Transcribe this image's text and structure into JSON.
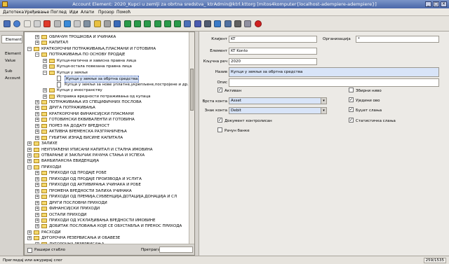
{
  "window": {
    "title": "Account Element: 2020_Kupci u zemlji za obrtna sredstva_ ktrAdmin@ktrl.kttorg [mitos4komputer{localhost-adempiere-adempiere}]",
    "close_glyph": "×",
    "max_glyph": "□",
    "min_glyph": "_"
  },
  "menu": [
    "Датотека",
    "Уређивање",
    "Поглед",
    "Иди",
    "Алати",
    "Прозор",
    "Помоћ"
  ],
  "toolbar": {
    "icons": [
      "undo-icon",
      "help-icon",
      "new-record-icon",
      "copy-record-icon",
      "delete-icon",
      "save-icon",
      "refresh-icon",
      "find-icon",
      "attachment-icon",
      "chat-icon",
      "history-icon",
      "home-icon",
      "parent-record-icon",
      "detail-record-icon",
      "first-record-icon",
      "previous-record-icon",
      "next-record-icon",
      "last-record-icon",
      "report-icon",
      "archive-icon",
      "print-icon",
      "zoom-across-icon",
      "active-workflows-icon",
      "requests-icon",
      "product-info-icon",
      "close-window-icon"
    ],
    "colors": [
      "#4a6fb8",
      "#4a7fd0",
      "#e8e6e0",
      "#d0d0d0",
      "#e03a2a",
      "#b8b8b8",
      "#3a8ad8",
      "#c8c8c8",
      "#8090a0",
      "#e8c040",
      "#a0a0a0",
      "#3a6ab8",
      "#2a9a4a",
      "#2a9a4a",
      "#2a9a4a",
      "#2a9a4a",
      "#2a9a4a",
      "#2a9a4a",
      "#4a6fb8",
      "#4a5ab0",
      "#505a70",
      "#3a7ac8",
      "#5070a0",
      "#606060",
      "#9090a0",
      "#d02020"
    ]
  },
  "left_tabs": [
    "Element",
    "Element Value",
    "Sub Account"
  ],
  "tree": {
    "nodes": [
      {
        "label": "ОБРАЧУН ТРОШКОВА И УЧИНАКА",
        "level": 1,
        "expanded": false,
        "folder": true
      },
      {
        "label": "КАПИТАЛ",
        "level": 1,
        "expanded": false,
        "folder": true
      },
      {
        "label": "КРАТКОРОЧНИ ПОТРАЖИВАЊА,ПЛАСМАНИ И ГОТОВИНА",
        "level": 0,
        "expanded": true,
        "folder": true
      },
      {
        "label": "ПОТРАЖИВАЊА ПО ОСНОВУ ПРОДАЈЕ",
        "level": 1,
        "expanded": true,
        "folder": true
      },
      {
        "label": "Купци-матична и зависна правна лица",
        "level": 2,
        "expanded": false,
        "folder": true
      },
      {
        "label": "Купци-остала повезана правна лица",
        "level": 2,
        "expanded": false,
        "folder": true
      },
      {
        "label": "Купци у земљи",
        "level": 2,
        "expanded": true,
        "folder": true
      },
      {
        "label": "Купци у земљи за обртна средства",
        "level": 3,
        "expanded": false,
        "folder": false,
        "selected": true
      },
      {
        "label": "Купци у земљи за нове уплатне,укрепљене,постројене и др.",
        "level": 3,
        "expanded": false,
        "folder": false
      },
      {
        "label": "Купци у иностранству",
        "level": 2,
        "expanded": false,
        "folder": true
      },
      {
        "label": "Исправка вредности потраживања од купаца",
        "level": 2,
        "expanded": false,
        "folder": true
      },
      {
        "label": "ПОТРАЖИВАЊА ИЗ СПЕЦИФИЧНИХ ПОСЛОВА",
        "level": 1,
        "expanded": false,
        "folder": true
      },
      {
        "label": "ДРУГА ПОТРАЖИВАЊА",
        "level": 1,
        "expanded": false,
        "folder": true
      },
      {
        "label": "КРАТКОРОЧНИ ФИНАНСИЈСКИ ПЛАСМАНИ",
        "level": 1,
        "expanded": false,
        "folder": true
      },
      {
        "label": "ГОТОВИНСКИ ЕКВИВАЛЕНТИ И ГОТОВИНА",
        "level": 1,
        "expanded": false,
        "folder": true
      },
      {
        "label": "ПОРЕЗ НА ДОДАТУ ВРЕДНОСТ",
        "level": 1,
        "expanded": false,
        "folder": true
      },
      {
        "label": "АКТИВНА ВРЕМЕНСКА РАЗГРАНИЧЕЊА",
        "level": 1,
        "expanded": false,
        "folder": true
      },
      {
        "label": "ГУБИТАК ИЗНАД ВИСИНЕ КАПИТАЛА",
        "level": 1,
        "expanded": false,
        "folder": true
      },
      {
        "label": "ЗАЛИХЕ",
        "level": 0,
        "expanded": false,
        "folder": true
      },
      {
        "label": "НЕУПЛАЋЕНИ УПИСАНИ КАПИТАЛ И СТАЛНА ИМОВИНА",
        "level": 0,
        "expanded": false,
        "folder": true
      },
      {
        "label": "ОТВАРАЊЕ И ЗАКЉУЧАК РАЧУНА СТАЊА И УСПЕХА",
        "level": 0,
        "expanded": false,
        "folder": true
      },
      {
        "label": "ВАНБИЛАНСНА ЕВИДЕНЦИЈА",
        "level": 0,
        "expanded": false,
        "folder": true
      },
      {
        "label": "ПРИХОДИ",
        "level": 0,
        "expanded": true,
        "folder": true
      },
      {
        "label": "ПРИХОДИ ОД ПРОДАЈЕ РОБЕ",
        "level": 1,
        "expanded": false,
        "folder": true
      },
      {
        "label": "ПРИХОДИ ОД ПРОДАЈЕ ПРОИЗВОДА И УСЛУГА",
        "level": 1,
        "expanded": false,
        "folder": true
      },
      {
        "label": "ПРИХОДИ ОД АКТИВИРАЊА УЧИНАКА И РОБЕ",
        "level": 1,
        "expanded": false,
        "folder": true
      },
      {
        "label": "ПРОМЕНА ВРЕДНОСТИ ЗАЛИХА УЧИНАКА",
        "level": 1,
        "expanded": false,
        "folder": true
      },
      {
        "label": "ПРИХОДИ ОД ПРЕМИЈА,СУБВЕНЦИЈА,ДОТАЦИЈА,ДОНАЦИЈА И СЛ",
        "level": 1,
        "expanded": false,
        "folder": true
      },
      {
        "label": "ДРУГИ ПОСЛОВНИ ПРИХОДИ",
        "level": 1,
        "expanded": false,
        "folder": true
      },
      {
        "label": "ФИНАНСИЈСКИ ПРИХОДИ",
        "level": 1,
        "expanded": false,
        "folder": true
      },
      {
        "label": "ОСТАЛИ ПРИХОДИ",
        "level": 1,
        "expanded": false,
        "folder": true
      },
      {
        "label": "ПРИХОДИ ОД УСКЛАЂИВАЊА ВРЕДНОСТИ ИМОВИНЕ",
        "level": 1,
        "expanded": false,
        "folder": true
      },
      {
        "label": "ДОБИТАК ПОСЛОВАЊА КОЈЕ СЕ ОБУСТАВЉА И ПРЕНОС ПРИХОДА",
        "level": 1,
        "expanded": false,
        "folder": true
      },
      {
        "label": "РАСХОДИ",
        "level": 0,
        "expanded": false,
        "folder": true
      },
      {
        "label": "ДУГОРОЧНА РЕЗЕРВИСАЊА И ОБАВЕЗЕ",
        "level": 0,
        "expanded": false,
        "folder": true
      },
      {
        "label": "ДУГОРОЧНА РЕЗЕРВИСАЊА",
        "level": 1,
        "expanded": false,
        "folder": true
      }
    ],
    "expand_all_label": "Рашири стабло",
    "search_label": "Претрага"
  },
  "form": {
    "client_label": "Клијент",
    "client_value": "KT",
    "org_label": "Организација",
    "org_value": "*",
    "element_label": "Елемент",
    "element_value": "KT Konto",
    "search_key_label": "Кључна реч",
    "search_key_value": "2020",
    "name_label": "Назив",
    "name_value": "Купци у земљи за обртна средства",
    "description_label": "Опис",
    "description_value": "",
    "active_label": "Активан",
    "summary_label": "Збирни ниво",
    "account_type_label": "Врста конта",
    "account_type_value": "Asset",
    "natural_account_label": "Уједини ово",
    "account_sign_label": "Знак конта",
    "account_sign_value": "Debit",
    "budget_label": "Буџет слања",
    "doc_controlled_label": "Документ контролисан",
    "statistical_label": "Статистичка слања",
    "bank_account_label": "Рачун банке",
    "checked_glyph": "✓",
    "dropdown_glyph": "▾"
  },
  "status": {
    "message": "Прегледај или ажурирај слог",
    "record": "259/1535"
  }
}
